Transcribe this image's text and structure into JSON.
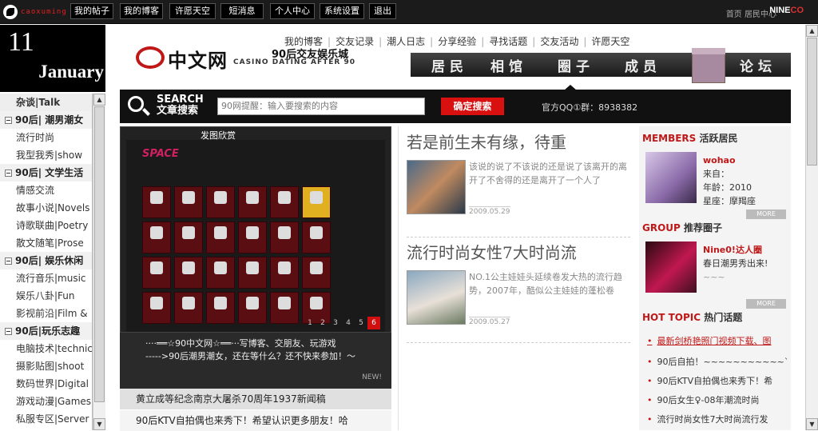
{
  "topbar": {
    "username": "caoxuming",
    "nav": [
      "我的帖子",
      "我的博客",
      "许愿天空",
      "短消息",
      "个人中心",
      "系统设置",
      "退出"
    ],
    "right_links": "首页 居民中心",
    "logo": "NINE",
    "logo_red": "CO"
  },
  "date": {
    "day": "11",
    "month": "January"
  },
  "sidebar": {
    "items": [
      {
        "label": "杂谈|Talk",
        "type": "first"
      },
      {
        "label": "90后| 潮男潮女",
        "type": "group"
      },
      {
        "label": "流行时尚",
        "type": "item"
      },
      {
        "label": "我型我秀|show",
        "type": "item"
      },
      {
        "label": "90后| 文学生活",
        "type": "group"
      },
      {
        "label": "情感交流",
        "type": "item"
      },
      {
        "label": "故事小说|Novels",
        "type": "item"
      },
      {
        "label": "诗歌联曲|Poetry",
        "type": "item"
      },
      {
        "label": "散文随笔|Prose",
        "type": "item"
      },
      {
        "label": "90后| 娱乐休闲",
        "type": "group"
      },
      {
        "label": "流行音乐|music",
        "type": "item"
      },
      {
        "label": "娱乐八卦|Fun",
        "type": "item"
      },
      {
        "label": "影视前沿|Film &",
        "type": "item"
      },
      {
        "label": "90后|玩乐志趣",
        "type": "group"
      },
      {
        "label": "电脑技术|technic",
        "type": "item"
      },
      {
        "label": "摄影贴图|shoot",
        "type": "item"
      },
      {
        "label": "数码世界|Digital",
        "type": "item"
      },
      {
        "label": "游戏动漫|Games",
        "type": "item"
      },
      {
        "label": "私服专区|Server",
        "type": "item"
      }
    ]
  },
  "brand": {
    "cn": "中文网",
    "sub": "90后交友娱乐城",
    "en": "CASINO DATING AFTER 90"
  },
  "links": [
    "我的博客",
    "交友记录",
    "潮人日志",
    "分享经验",
    "寻找话题",
    "交友活动",
    "许愿天空"
  ],
  "mainnav": [
    "居民",
    "相馆",
    "圈子",
    "成员",
    "论坛"
  ],
  "search": {
    "title1": "SEARCH",
    "title2": "文章搜索",
    "placeholder": "90网提醒：输入要搜索的内容",
    "button": "确定搜索",
    "qq": "官方QQ①群：8938382"
  },
  "slide": {
    "label": "发图欣赏",
    "space": "SPACE",
    "pages": [
      "1",
      "2",
      "3",
      "4",
      "5",
      "6"
    ],
    "caption1": "····══☆90中文网☆══···写博客、交朋友、玩游戏",
    "caption2": "----->90后潮男潮女，还在等什么？还不快来参加！～",
    "newtag": "NEW!"
  },
  "news": [
    "黄立成等纪念南京大屠杀70周年1937新闻稿",
    "90后KTV自拍偶也来秀下！希望认识更多朋友！哈"
  ],
  "articles": [
    {
      "title": "若是前生未有缘，待重",
      "text": "该说的说了不该说的还是说了该离开的离开了不舍得的还是离开了一个人了",
      "date": "2009.05.29"
    },
    {
      "title": "流行时尚女性7大时尚流",
      "text": "NO.1公主娃娃头延续卷发大热的流行趋势，2007年，酷似公主娃娃的蓬松卷",
      "date": "2009.05.27"
    }
  ],
  "members": {
    "title_en": "MEMBERS",
    "title_cn": "活跃居民",
    "name": "wohao",
    "l1": "来自：",
    "l2": "年龄：2010",
    "l3": "星座：摩羯座",
    "more": "MORE"
  },
  "group": {
    "title_en": "GROUP",
    "title_cn": "推荐圈子",
    "name": "Nine0!达人圈",
    "desc": "春日潮男秀出来!",
    "desc2": "~~~",
    "more": "MORE"
  },
  "hot": {
    "title_en": "HOT TOPIC",
    "title_cn": "热门话题",
    "items": [
      "最新剑桥艳照门视频下载、图",
      "90后自拍！~~~~~~~~~~~`",
      "90后KTV自拍偶也来秀下！希",
      "90后女生♀-08年潮流时尚",
      "流行时尚女性7大时尚流行发"
    ]
  },
  "colors": {
    "accent": "#c01818",
    "dark": "#111111"
  }
}
